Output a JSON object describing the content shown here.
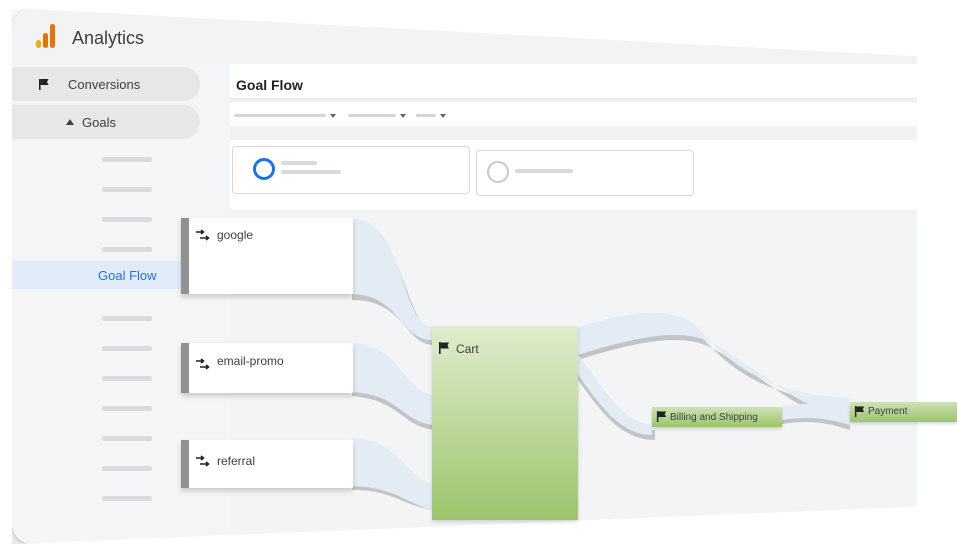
{
  "app": {
    "title": "Analytics",
    "logo_colors": [
      "#f9ab00",
      "#e37400",
      "#e37400"
    ]
  },
  "sidebar": {
    "section_label": "Conversions",
    "subsection_label": "Goals",
    "active_item": "Goal Flow"
  },
  "main": {
    "page_title": "Goal Flow"
  },
  "flow": {
    "sources": [
      "google",
      "email-promo",
      "referral"
    ],
    "steps": [
      "Cart",
      "Billing and Shipping",
      "Payment"
    ]
  },
  "colors": {
    "accent": "#1a73e8",
    "flow_link": "#e6edf6",
    "flow_shadow": "#9a9c9e",
    "goal_green": "#9cc46c"
  }
}
